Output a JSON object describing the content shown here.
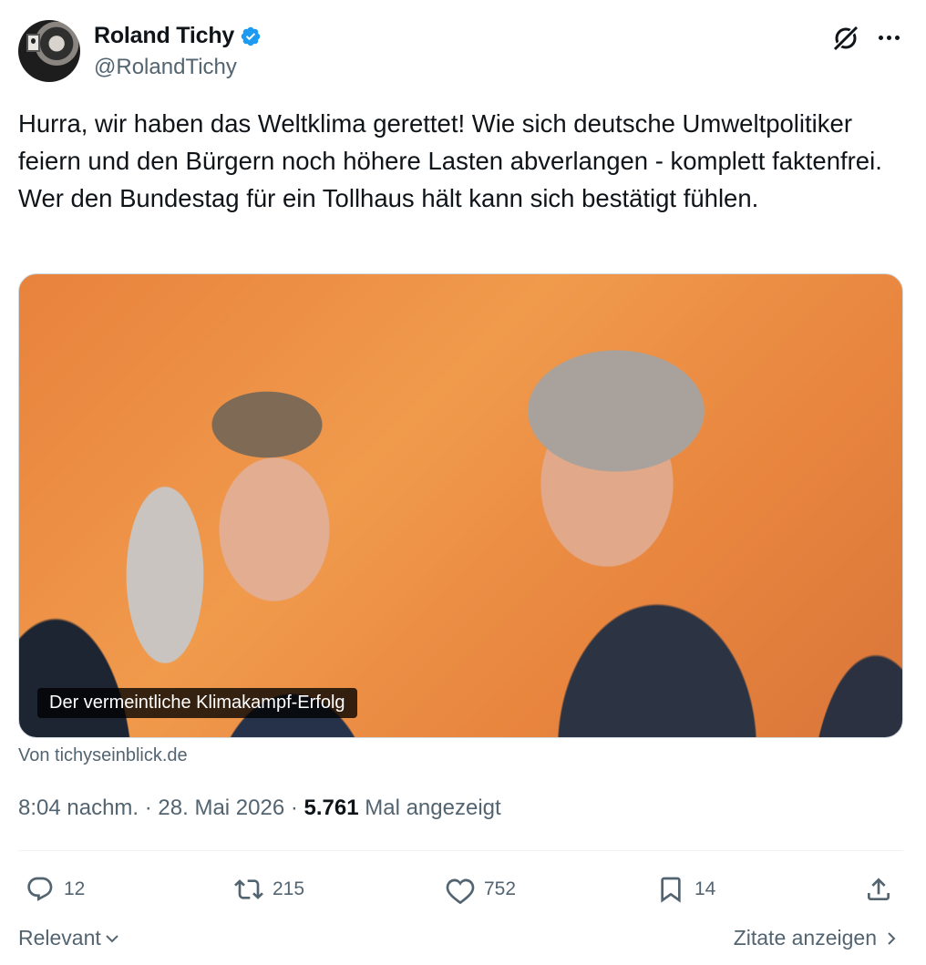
{
  "author": {
    "display_name": "Roland Tichy",
    "handle": "@RolandTichy",
    "verified": true,
    "verified_color": "#1d9bf0"
  },
  "header_icons": [
    "grok-icon",
    "more-icon"
  ],
  "tweet": {
    "text": "Hurra, wir haben das Weltklima gerettet! Wie sich deutsche Umweltpolitiker feiern und den Bürgern noch höhere Lasten abverlangen - komplett faktenfrei. Wer den Bundestag für ein Tollhaus hält kann sich bestätigt fühlen."
  },
  "card": {
    "caption": "Der vermeintliche Klimakampf-Erfolg",
    "source": "Von tichyseinblick.de"
  },
  "meta": {
    "time": "8:04 nachm.",
    "sep1": " · ",
    "date": "28. Mai 2026",
    "sep2": " · ",
    "views_count": "5.761",
    "views_label": " Mal angezeigt"
  },
  "actions": {
    "replies": "12",
    "reposts": "215",
    "likes": "752",
    "bookmarks": "14"
  },
  "footer": {
    "sort_label": "Relevant",
    "quotes_label": "Zitate anzeigen"
  },
  "colors": {
    "text": "#0f1419",
    "secondary": "#536471",
    "divider": "#eff3f4"
  }
}
